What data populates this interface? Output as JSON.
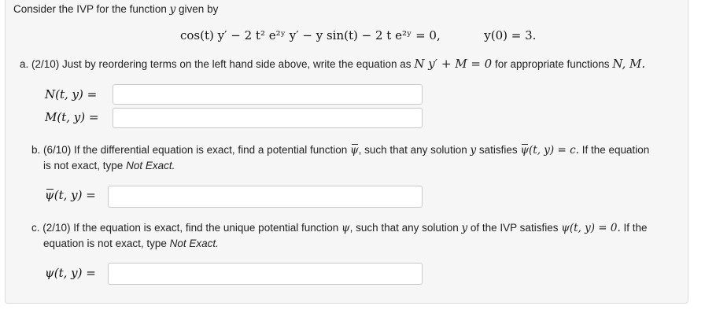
{
  "intro": "Consider the IVP for the function y given by",
  "intro_parts": {
    "text": "Consider the IVP for the function",
    "var": "y",
    "tail": "given by"
  },
  "ode": {
    "lhs": "cos(t) y′ − 2 t² e²ʸ y′ − y sin(t) − 2 t e²ʸ = 0,",
    "ic": "y(0) = 3."
  },
  "part_a": {
    "prefix": "a. (2/10) Just by reordering terms on the left hand side above, write the equation as",
    "form": "N y′ + M = 0",
    "suffix": "for appropriate functions",
    "funcs": "N, M.",
    "n_label": "N(t, y) =",
    "m_label": "M(t, y) =",
    "n_value": "",
    "m_value": ""
  },
  "part_b": {
    "line1_prefix": "b. (6/10) If the differential equation is exact, find a potential function",
    "line1_mid": ", such that any solution",
    "line1_var": "y",
    "line1_sat": "satisfies",
    "line1_eq": "(t, y) = c.",
    "line1_suffix": "If the equation",
    "line2_prefix": "is not exact, type",
    "not_exact": "Not Exact.",
    "label": "(t, y) =",
    "value": ""
  },
  "part_c": {
    "line1_prefix": "c. (2/10) If the equation is exact, find the unique potential function",
    "line1_mid": ", such that any solution",
    "line1_var": "y",
    "line1_sat": "of the IVP satisfies",
    "line1_eq": "(t, y) = 0.",
    "line1_suffix": "If the",
    "line2_prefix": "equation is not exact, type",
    "not_exact": "Not Exact.",
    "label": "(t, y) =",
    "value": ""
  },
  "symbols": {
    "psi": "ψ",
    "psi_bar": "ψ"
  }
}
